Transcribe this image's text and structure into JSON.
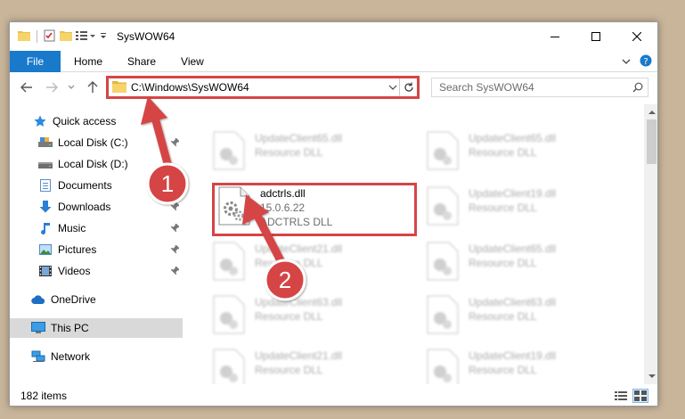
{
  "window": {
    "title": "SysWOW64"
  },
  "ribbon": {
    "tabs": [
      "File",
      "Home",
      "Share",
      "View"
    ]
  },
  "address": {
    "path": "C:\\Windows\\SysWOW64"
  },
  "search": {
    "placeholder": "Search SysWOW64"
  },
  "sidebar": {
    "items": [
      {
        "label": "Quick access",
        "icon": "star-icon"
      },
      {
        "label": "Local Disk (C:)",
        "icon": "drive-icon"
      },
      {
        "label": "Local Disk (D:)",
        "icon": "drive-icon"
      },
      {
        "label": "Documents",
        "icon": "documents-icon"
      },
      {
        "label": "Downloads",
        "icon": "downloads-icon"
      },
      {
        "label": "Music",
        "icon": "music-icon"
      },
      {
        "label": "Pictures",
        "icon": "pictures-icon"
      },
      {
        "label": "Videos",
        "icon": "videos-icon"
      },
      {
        "label": "OneDrive",
        "icon": "cloud-icon"
      },
      {
        "label": "This PC",
        "icon": "computer-icon"
      },
      {
        "label": "Network",
        "icon": "network-icon"
      }
    ]
  },
  "files": [
    {
      "name": "UpdateClient65.dll",
      "type": "Resource DLL"
    },
    {
      "name": "UpdateClient65.dll",
      "type": "Resource DLL"
    },
    {
      "name": "adctrls.dll",
      "version": "15.0.6.22",
      "type": "ADCTRLS DLL"
    },
    {
      "name": "UpdateClient19.dll",
      "type": "Resource DLL"
    },
    {
      "name": "UpdateClient21.dll",
      "type": "Resource DLL"
    },
    {
      "name": "UpdateClient65.dll",
      "type": "Resource DLL"
    },
    {
      "name": "UpdateClient63.dll",
      "type": "Resource DLL"
    },
    {
      "name": "UpdateClient63.dll",
      "type": "Resource DLL"
    },
    {
      "name": "UpdateClient21.dll",
      "type": "Resource DLL"
    },
    {
      "name": "UpdateClient19.dll",
      "type": "Resource DLL"
    }
  ],
  "status": {
    "count": "182 items"
  },
  "annotations": {
    "step1": "1",
    "step2": "2",
    "color": "#d64545"
  },
  "colors": {
    "file_tab": "#1979ca",
    "highlight": "#d64545"
  }
}
